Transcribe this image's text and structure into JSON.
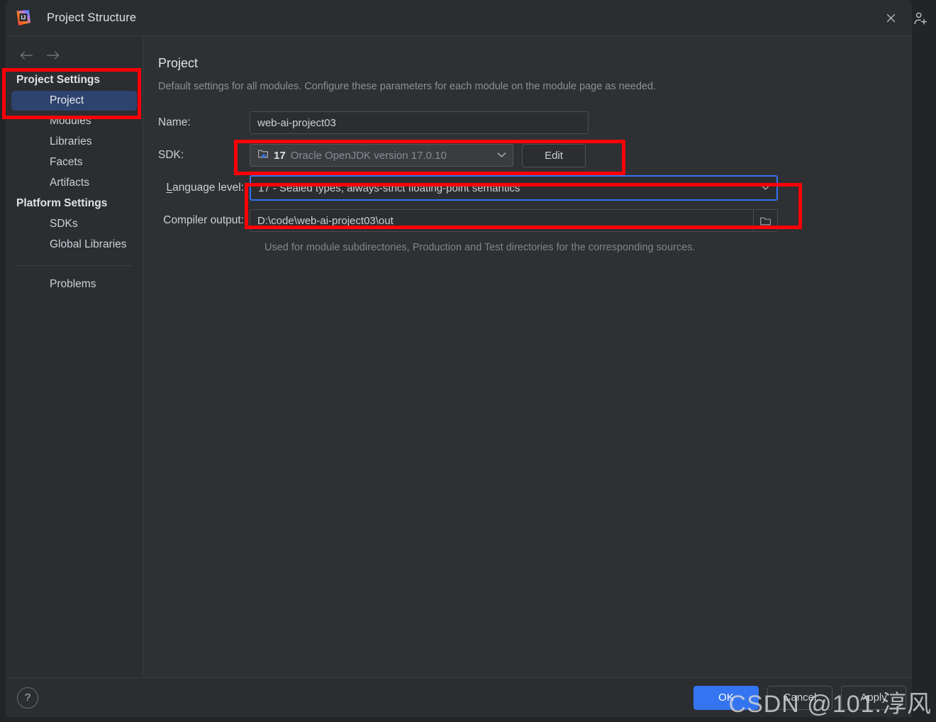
{
  "window": {
    "title": "Project Structure",
    "logo_icon": "intellij-idea-logo",
    "close_icon": "close-icon",
    "add_user_icon": "add-user-icon"
  },
  "nav": {
    "back_icon": "arrow-left-icon",
    "forward_icon": "arrow-right-icon"
  },
  "sidebar": {
    "groups": [
      {
        "label": "Project Settings",
        "items": [
          {
            "label": "Project",
            "selected": true
          },
          {
            "label": "Modules",
            "selected": false
          },
          {
            "label": "Libraries",
            "selected": false
          },
          {
            "label": "Facets",
            "selected": false
          },
          {
            "label": "Artifacts",
            "selected": false
          }
        ]
      },
      {
        "label": "Platform Settings",
        "items": [
          {
            "label": "SDKs",
            "selected": false
          },
          {
            "label": "Global Libraries",
            "selected": false
          }
        ]
      }
    ],
    "footer_items": [
      {
        "label": "Problems",
        "selected": false
      }
    ]
  },
  "main": {
    "title": "Project",
    "subtitle": "Default settings for all modules. Configure these parameters for each module on the module page as needed.",
    "fields": {
      "name": {
        "label": "Name:",
        "value": "web-ai-project03"
      },
      "sdk": {
        "label": "SDK:",
        "icon": "java-sdk-icon",
        "version": "17",
        "description": "Oracle OpenJDK version 17.0.10",
        "caret_icon": "chevron-down-icon",
        "edit_label": "Edit"
      },
      "language_level": {
        "label_prefix": "L",
        "label_rest": "anguage level:",
        "value": "17 - Sealed types, always-strict floating-point semantics",
        "caret_icon": "chevron-down-icon"
      },
      "compiler_output": {
        "label": "Compiler output:",
        "value": "D:\\code\\web-ai-project03\\out",
        "browse_icon": "folder-icon",
        "hint": "Used for module subdirectories, Production and Test directories for the corresponding sources."
      }
    }
  },
  "footer": {
    "help_icon": "help-icon",
    "help_label": "?",
    "buttons": [
      {
        "label": "OK",
        "primary": true
      },
      {
        "label": "Cancel",
        "primary": false
      },
      {
        "label": "Apply",
        "primary": false
      }
    ]
  },
  "watermark": {
    "text": "CSDN @101.淳风"
  },
  "colors": {
    "accent": "#3574f0",
    "annotation": "#fb0007",
    "selection": "#2e436e",
    "dialog_bg": "#2b2d30",
    "content_bg": "#2f3033"
  }
}
